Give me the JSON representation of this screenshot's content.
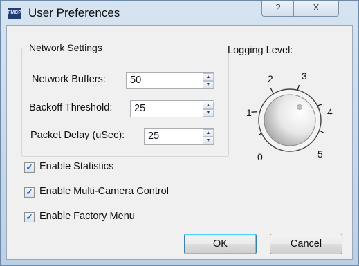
{
  "window": {
    "app_icon_text": "FMCP",
    "title": "User Preferences",
    "help_label": "?",
    "close_label": "X"
  },
  "network": {
    "group_title": "Network Settings",
    "fields": [
      {
        "label": "Network Buffers:",
        "value": "50"
      },
      {
        "label": "Backoff Threshold:",
        "value": "25"
      },
      {
        "label": "Packet Delay (uSec):",
        "value": "25"
      }
    ]
  },
  "logging": {
    "label": "Logging Level:",
    "levels": [
      "0",
      "1",
      "2",
      "3",
      "4",
      "5"
    ]
  },
  "options": [
    {
      "label": "Enable Statistics",
      "checked": true
    },
    {
      "label": "Enable Multi-Camera Control",
      "checked": true
    },
    {
      "label": "Enable Factory Menu",
      "checked": true
    }
  ],
  "buttons": {
    "ok": "OK",
    "cancel": "Cancel"
  },
  "icons": {
    "spin_up": "▲",
    "spin_down": "▼",
    "check": "✓"
  }
}
